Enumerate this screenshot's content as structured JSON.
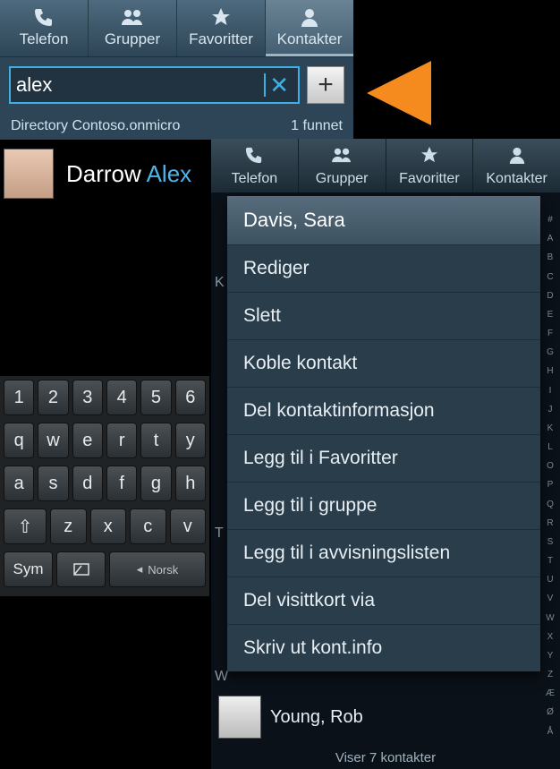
{
  "screenA": {
    "tabs": [
      "Telefon",
      "Grupper",
      "Favoritter",
      "Kontakter"
    ],
    "activeTab": 3,
    "search": {
      "value": "alex",
      "clearIcon": "✕"
    },
    "addLabel": "+",
    "directoryLabel": "Directory Contoso.onmicro",
    "resultCount": "1 funnet",
    "contact": {
      "first": "Darrow",
      "hl": "Alex"
    }
  },
  "keyboard": {
    "row1": [
      "1",
      "2",
      "3",
      "4",
      "5",
      "6"
    ],
    "row2": [
      "q",
      "w",
      "e",
      "r",
      "t",
      "y"
    ],
    "row3": [
      "a",
      "s",
      "d",
      "f",
      "g",
      "h"
    ],
    "row4": [
      "z",
      "x",
      "c",
      "v"
    ],
    "shift": "⇧",
    "sym": "Sym",
    "lang": "Norsk",
    "langArrow": "◂"
  },
  "screenB": {
    "tabs": [
      "Telefon",
      "Grupper",
      "Favoritter",
      "Kontakter"
    ],
    "menuTitle": "Davis, Sara",
    "menuItems": [
      "Rediger",
      "Slett",
      "Koble kontakt",
      "Del kontaktinformasjon",
      "Legg til i Favoritter",
      "Legg til i gruppe",
      "Legg til i avvisningslisten",
      "Del visittkort via",
      "Skriv ut kont.info"
    ],
    "visibleContact": "Young, Rob",
    "footer": "Viser 7 kontakter",
    "index": [
      "#",
      "A",
      "B",
      "C",
      "D",
      "E",
      "F",
      "G",
      "H",
      "I",
      "J",
      "K",
      "L",
      "",
      "",
      "O",
      "P",
      "Q",
      "R",
      "S",
      "T",
      "U",
      "V",
      "W",
      "X",
      "Y",
      "Z",
      "Æ",
      "Ø",
      "Å"
    ],
    "peekK": "K",
    "peekT": "T",
    "peekW": "W"
  }
}
